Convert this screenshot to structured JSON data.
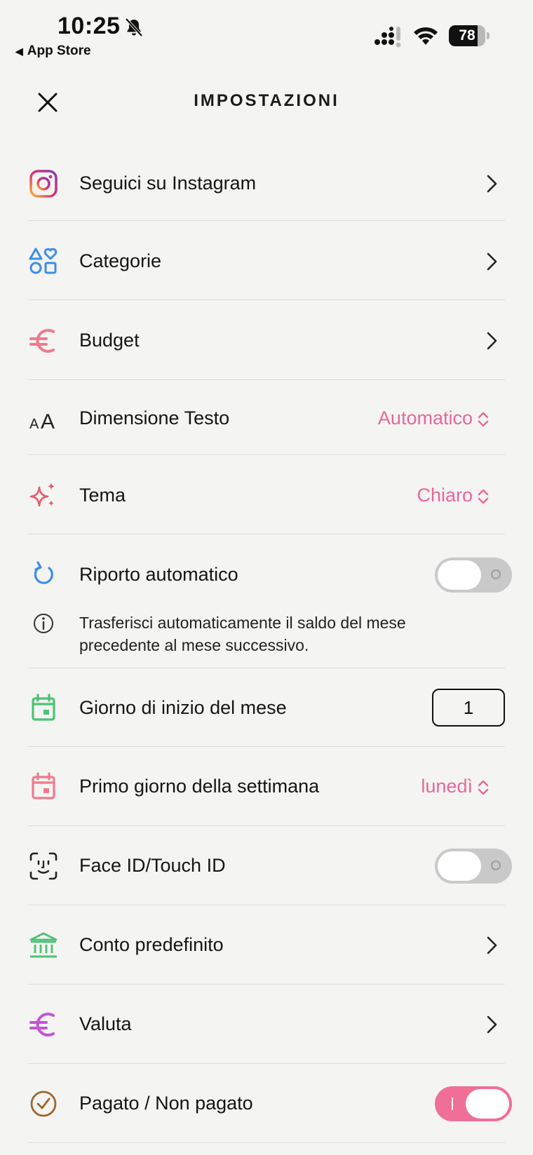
{
  "status_bar": {
    "time": "10:25",
    "back_app": "App Store",
    "battery": "78",
    "battery_level": 0.78
  },
  "header": {
    "title": "IMPOSTAZIONI"
  },
  "colors": {
    "accent": "#e8679a",
    "toggle_on": "#f06f97",
    "toggle_off": "#c9c9c9"
  },
  "settings": {
    "instagram": {
      "label": "Seguici su Instagram",
      "icon": "instagram-icon"
    },
    "categories": {
      "label": "Categorie",
      "icon": "categories-icon"
    },
    "budget": {
      "label": "Budget",
      "icon": "euro-icon"
    },
    "text_size": {
      "label": "Dimensione Testo",
      "value": "Automatico",
      "icon": "text-size-icon"
    },
    "theme": {
      "label": "Tema",
      "value": "Chiaro",
      "icon": "sparkles-icon"
    },
    "auto_carry": {
      "label": "Riporto automatico",
      "enabled": false,
      "info_line1": "Trasferisci automaticamente il saldo del mese",
      "info_line2": "precedente al mese successivo.",
      "icon": "refresh-icon"
    },
    "month_start": {
      "label": "Giorno di inizio del mese",
      "value": "1",
      "icon": "calendar-icon"
    },
    "week_start": {
      "label": "Primo giorno della settimana",
      "value": "lunedì",
      "icon": "calendar-icon"
    },
    "face_id": {
      "label": "Face ID/Touch ID",
      "enabled": false,
      "icon": "face-id-icon"
    },
    "default_account": {
      "label": "Conto predefinito",
      "icon": "bank-icon"
    },
    "currency": {
      "label": "Valuta",
      "icon": "euro-icon"
    },
    "paid_unpaid": {
      "label": "Pagato / Non pagato",
      "enabled": true,
      "icon": "check-circle-icon"
    }
  }
}
